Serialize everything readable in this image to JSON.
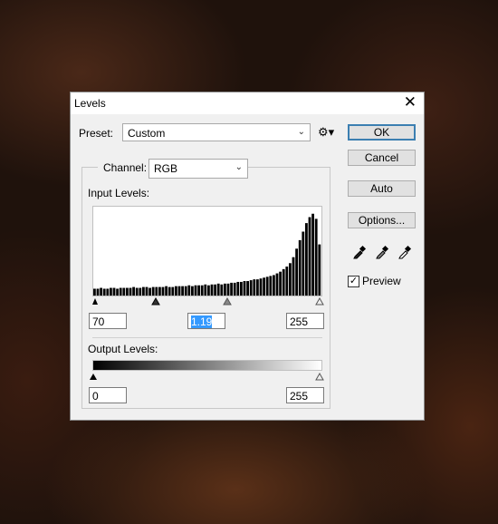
{
  "dialog": {
    "title": "Levels",
    "close_glyph": "✕",
    "preset_label": "Preset:",
    "preset_value": "Custom",
    "channel_label": "Channel:",
    "channel_value": "RGB",
    "input_levels_label": "Input Levels:",
    "output_levels_label": "Output Levels:",
    "input_black": "70",
    "input_gamma": "1.19",
    "input_white": "255",
    "output_black": "0",
    "output_white": "255",
    "buttons": {
      "ok": "OK",
      "cancel": "Cancel",
      "auto": "Auto",
      "options": "Options..."
    },
    "preview_label": "Preview",
    "preview_checked": true,
    "icons": [
      "gear-icon",
      "black-eyedropper-icon",
      "gray-eyedropper-icon",
      "white-eyedropper-icon"
    ]
  },
  "chart_data": {
    "type": "histogram",
    "x_range": [
      0,
      255
    ],
    "input_black": 70,
    "input_gamma": 1.19,
    "input_white": 255,
    "values": [
      0.08,
      0.08,
      0.09,
      0.08,
      0.08,
      0.09,
      0.09,
      0.08,
      0.09,
      0.09,
      0.09,
      0.09,
      0.1,
      0.09,
      0.09,
      0.1,
      0.1,
      0.09,
      0.1,
      0.1,
      0.1,
      0.1,
      0.11,
      0.1,
      0.1,
      0.11,
      0.11,
      0.11,
      0.11,
      0.12,
      0.11,
      0.12,
      0.12,
      0.12,
      0.13,
      0.12,
      0.13,
      0.13,
      0.14,
      0.13,
      0.14,
      0.14,
      0.15,
      0.15,
      0.16,
      0.16,
      0.17,
      0.17,
      0.18,
      0.19,
      0.19,
      0.2,
      0.21,
      0.22,
      0.23,
      0.24,
      0.26,
      0.28,
      0.31,
      0.34,
      0.38,
      0.45,
      0.55,
      0.65,
      0.75,
      0.85,
      0.92,
      0.96,
      0.9,
      0.6
    ]
  }
}
